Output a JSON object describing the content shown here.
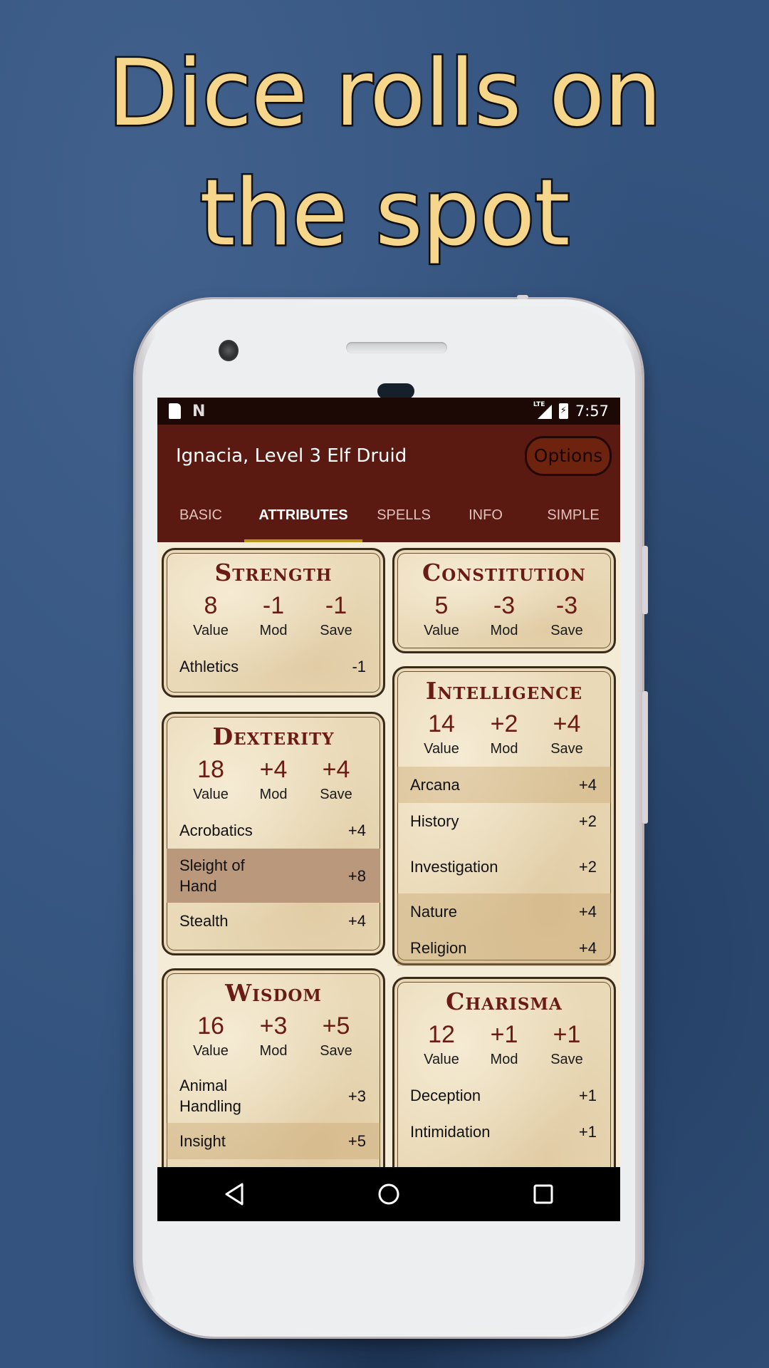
{
  "headline": {
    "line1": "Dice rolls on",
    "line2": "the spot"
  },
  "statusbar": {
    "left_icons": [
      "sd-card-icon",
      "n-notification-icon"
    ],
    "network_label": "LTE",
    "time": "7:57"
  },
  "appbar": {
    "title": "Ignacia, Level 3 Elf Druid",
    "options_label": "Options"
  },
  "tabs": [
    {
      "label": "BASIC",
      "active": false
    },
    {
      "label": "ATTRIBUTES",
      "active": true
    },
    {
      "label": "SPELLS",
      "active": false
    },
    {
      "label": "INFO",
      "active": false
    },
    {
      "label": "SIMPLE",
      "active": false
    }
  ],
  "stat_labels": {
    "value": "Value",
    "mod": "Mod",
    "save": "Save"
  },
  "attributes": {
    "strength": {
      "name": "Strength",
      "value": "8",
      "mod": "-1",
      "save": "-1",
      "skills": [
        {
          "name": "Athletics",
          "bonus": "-1",
          "highlight": "none"
        }
      ]
    },
    "constitution": {
      "name": "Constitution",
      "value": "5",
      "mod": "-3",
      "save": "-3",
      "skills": []
    },
    "dexterity": {
      "name": "Dexterity",
      "value": "18",
      "mod": "+4",
      "save": "+4",
      "skills": [
        {
          "name": "Acrobatics",
          "bonus": "+4",
          "highlight": "none"
        },
        {
          "name": "Sleight of Hand",
          "bonus": "+8",
          "highlight": "expertise"
        },
        {
          "name": "Stealth",
          "bonus": "+4",
          "highlight": "none"
        }
      ]
    },
    "intelligence": {
      "name": "Intelligence",
      "value": "14",
      "mod": "+2",
      "save": "+4",
      "skills": [
        {
          "name": "Arcana",
          "bonus": "+4",
          "highlight": "proficient"
        },
        {
          "name": "History",
          "bonus": "+2",
          "highlight": "none"
        },
        {
          "name": "Investigation",
          "bonus": "+2",
          "highlight": "none"
        },
        {
          "name": "Nature",
          "bonus": "+4",
          "highlight": "proficient"
        },
        {
          "name": "Religion",
          "bonus": "+4",
          "highlight": "proficient"
        }
      ]
    },
    "wisdom": {
      "name": "Wisdom",
      "value": "16",
      "mod": "+3",
      "save": "+5",
      "skills": [
        {
          "name": "Animal Handling",
          "bonus": "+3",
          "highlight": "none"
        },
        {
          "name": "Insight",
          "bonus": "+5",
          "highlight": "proficient"
        }
      ]
    },
    "charisma": {
      "name": "Charisma",
      "value": "12",
      "mod": "+1",
      "save": "+1",
      "skills": [
        {
          "name": "Deception",
          "bonus": "+1",
          "highlight": "none"
        },
        {
          "name": "Intimidation",
          "bonus": "+1",
          "highlight": "none"
        }
      ]
    }
  },
  "navbar": {
    "buttons": [
      "back-icon",
      "home-icon",
      "recents-icon"
    ]
  },
  "colors": {
    "appbar": "#5a1911",
    "statusbar": "#1c0905",
    "tab_indicator": "#b8961c",
    "title_red": "#6a1c14",
    "parchment": "#e9d9b7",
    "headline_yellow": "#f6d68a",
    "background_blue": "#34547f"
  }
}
